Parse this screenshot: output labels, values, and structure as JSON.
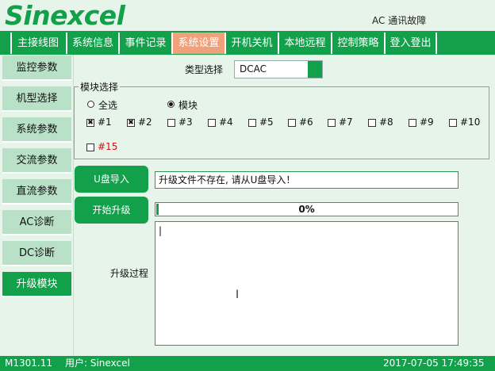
{
  "header": {
    "logo": "Sinexcel",
    "alarm_text": "AC 通讯故障"
  },
  "nav": {
    "tabs": [
      {
        "label": "主接线图"
      },
      {
        "label": "系统信息"
      },
      {
        "label": "事件记录"
      },
      {
        "label": "系统设置"
      },
      {
        "label": "开机关机"
      },
      {
        "label": "本地远程"
      },
      {
        "label": "控制策略"
      },
      {
        "label": "登入登出"
      }
    ],
    "active_index": 3
  },
  "sidebar": {
    "items": [
      {
        "label": "监控参数"
      },
      {
        "label": "机型选择"
      },
      {
        "label": "系统参数"
      },
      {
        "label": "交流参数"
      },
      {
        "label": "直流参数"
      },
      {
        "label": "AC诊断"
      },
      {
        "label": "DC诊断"
      },
      {
        "label": "升级模块"
      }
    ],
    "active_index": 7
  },
  "main": {
    "type_select": {
      "label": "类型选择",
      "value": "DCAC"
    },
    "module_group": {
      "title": "模块选择",
      "radio_all": {
        "label": "全选",
        "checked": false
      },
      "radio_module": {
        "label": "模块",
        "checked": true
      },
      "checkboxes": [
        {
          "label": "#1",
          "checked": true
        },
        {
          "label": "#2",
          "checked": true
        },
        {
          "label": "#3",
          "checked": false
        },
        {
          "label": "#4",
          "checked": false
        },
        {
          "label": "#5",
          "checked": false
        },
        {
          "label": "#6",
          "checked": false
        },
        {
          "label": "#7",
          "checked": false
        },
        {
          "label": "#8",
          "checked": false
        },
        {
          "label": "#9",
          "checked": false
        },
        {
          "label": "#10",
          "checked": false
        },
        {
          "label": "#15",
          "checked": false
        }
      ],
      "check_mark": "✖"
    },
    "usb_import_button": "U盘导入",
    "message": "升级文件不存在, 请从U盘导入！",
    "start_upgrade_button": "开始升级",
    "progress": {
      "percent": 0,
      "text": "0%"
    },
    "process_label": "升级过程",
    "log_text": "|"
  },
  "status_bar": {
    "version": "M1301.11",
    "user": "用户: Sinexcel",
    "datetime": "2017-07-05 17:49:35"
  },
  "colors": {
    "brand_green": "#12a04a",
    "active_tab": "#f0a07a",
    "sidebar_bg": "#b9e1c7",
    "page_bg": "#e6f4ea",
    "alert_red": "#d01010"
  }
}
